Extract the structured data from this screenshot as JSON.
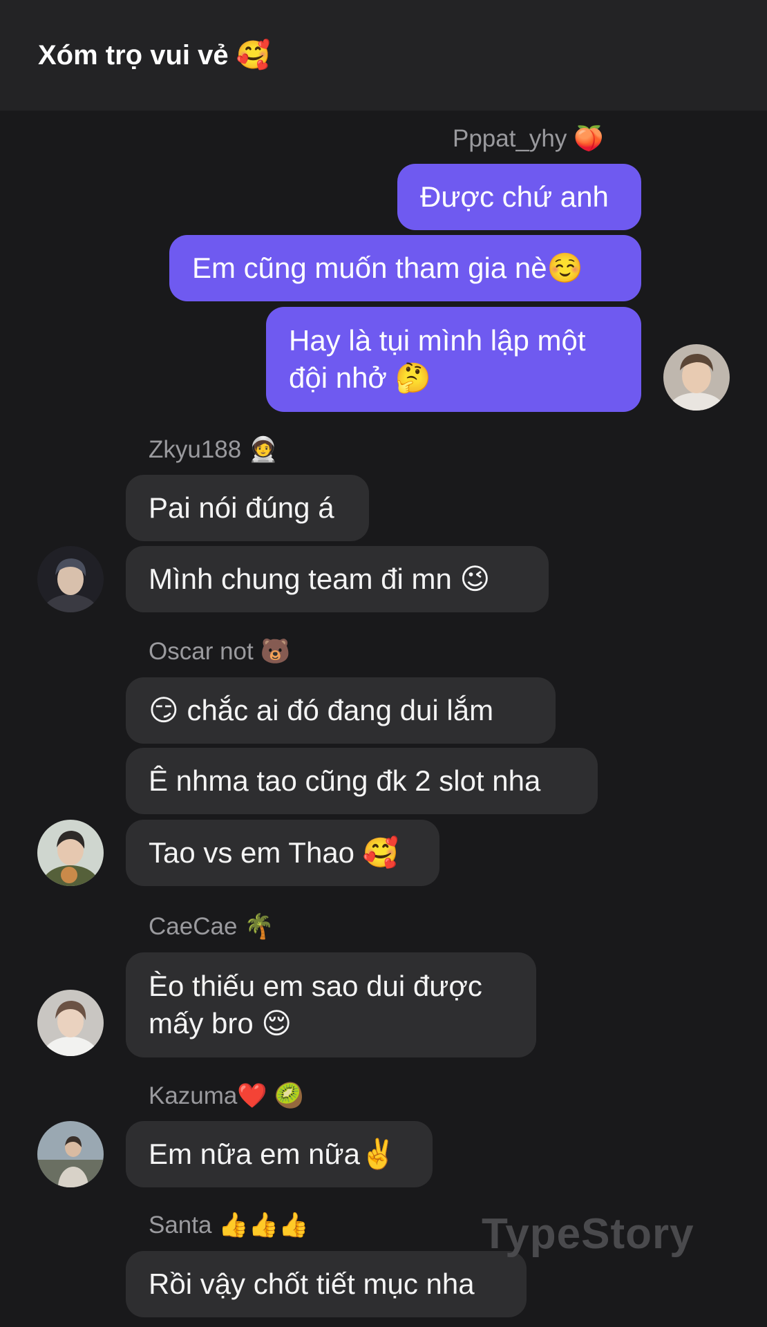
{
  "header": {
    "title": "Xóm trọ vui vẻ 🥰"
  },
  "messages": {
    "sender_pppat": "Pppat_yhy 🍑",
    "out_1": "Được chứ anh",
    "out_2": "Em cũng muốn tham gia nè☺️",
    "out_3": "Hay là tụi mình lập một đội nhở 🤔",
    "sender_zkyu": "Zkyu188 🧑‍🚀",
    "zkyu_1": "Pai nói đúng á",
    "zkyu_2": "Mình chung team đi mn 😉",
    "sender_oscar": "Oscar not 🐻",
    "oscar_1": "😏 chắc ai đó đang dui lắm",
    "oscar_2": "Ê nhma tao cũng đk 2 slot nha",
    "oscar_3": "Tao vs em Thao 🥰",
    "sender_caecae": "CaeCae 🌴",
    "caecae_1": "Èo thiếu em sao dui được mấy bro 😌",
    "sender_kazuma": "Kazuma❤️ 🥝",
    "kazuma_1": "Em nữa em nữa✌️",
    "sender_santa": "Santa 👍👍👍",
    "santa_1": "Rồi vậy chốt tiết mục nha"
  },
  "watermark": "TypeStory",
  "colors": {
    "background": "#19191b",
    "header": "#232325",
    "incoming_bubble": "#2e2e30",
    "outgoing_bubble": "#6f5af0",
    "sender_name": "#9a9a9e"
  }
}
